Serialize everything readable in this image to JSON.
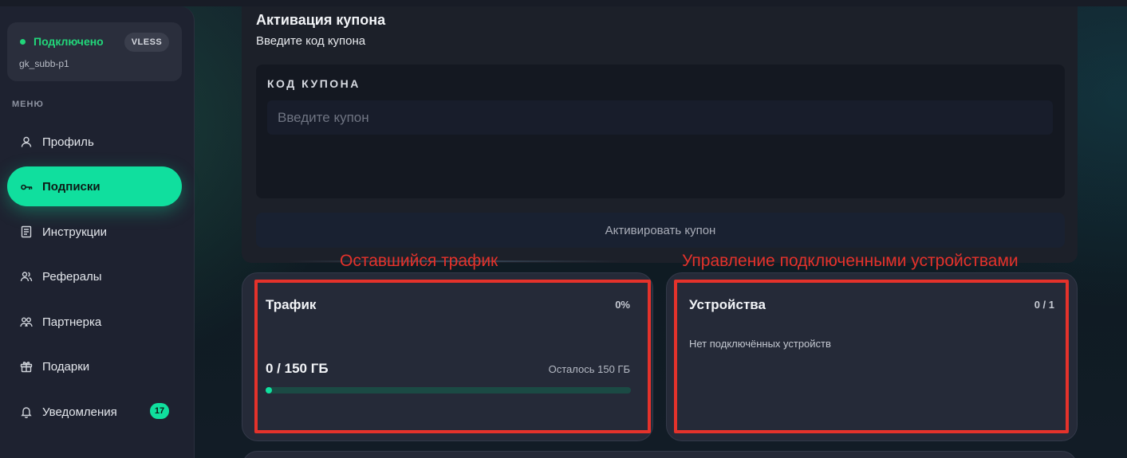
{
  "sidebar": {
    "status": {
      "text": "Подключено",
      "protocol": "VLESS",
      "subscription_name": "gk_subb-p1"
    },
    "menu_caption": "МЕНЮ",
    "items": [
      {
        "label": "Профиль",
        "icon": "user-icon"
      },
      {
        "label": "Подписки",
        "icon": "key-icon",
        "active": true
      },
      {
        "label": "Инструкции",
        "icon": "document-icon"
      },
      {
        "label": "Рефералы",
        "icon": "users-icon"
      },
      {
        "label": "Партнерка",
        "icon": "partners-icon"
      },
      {
        "label": "Подарки",
        "icon": "gift-icon"
      },
      {
        "label": "Уведомления",
        "icon": "bell-icon",
        "badge": "17"
      }
    ]
  },
  "coupon": {
    "title": "Активация купона",
    "subtitle": "Введите код купона",
    "field_label": "КОД КУПОНА",
    "input_value": "",
    "input_placeholder": "Введите купон",
    "button_label": "Активировать купон"
  },
  "annotations": {
    "traffic": "Оставшийся трафик",
    "devices": "Управление подключенными устройствами"
  },
  "traffic": {
    "title": "Трафик",
    "percent_label": "0%",
    "percent_value": 0,
    "used_label": "0 / 150 ГБ",
    "remaining_label": "Осталось 150 ГБ"
  },
  "devices": {
    "title": "Устройства",
    "count": "0 / 1",
    "empty_text": "Нет подключённых устройств"
  },
  "colors": {
    "accent": "#10df9e",
    "connected": "#22d67a",
    "annotation": "#e4322b"
  }
}
